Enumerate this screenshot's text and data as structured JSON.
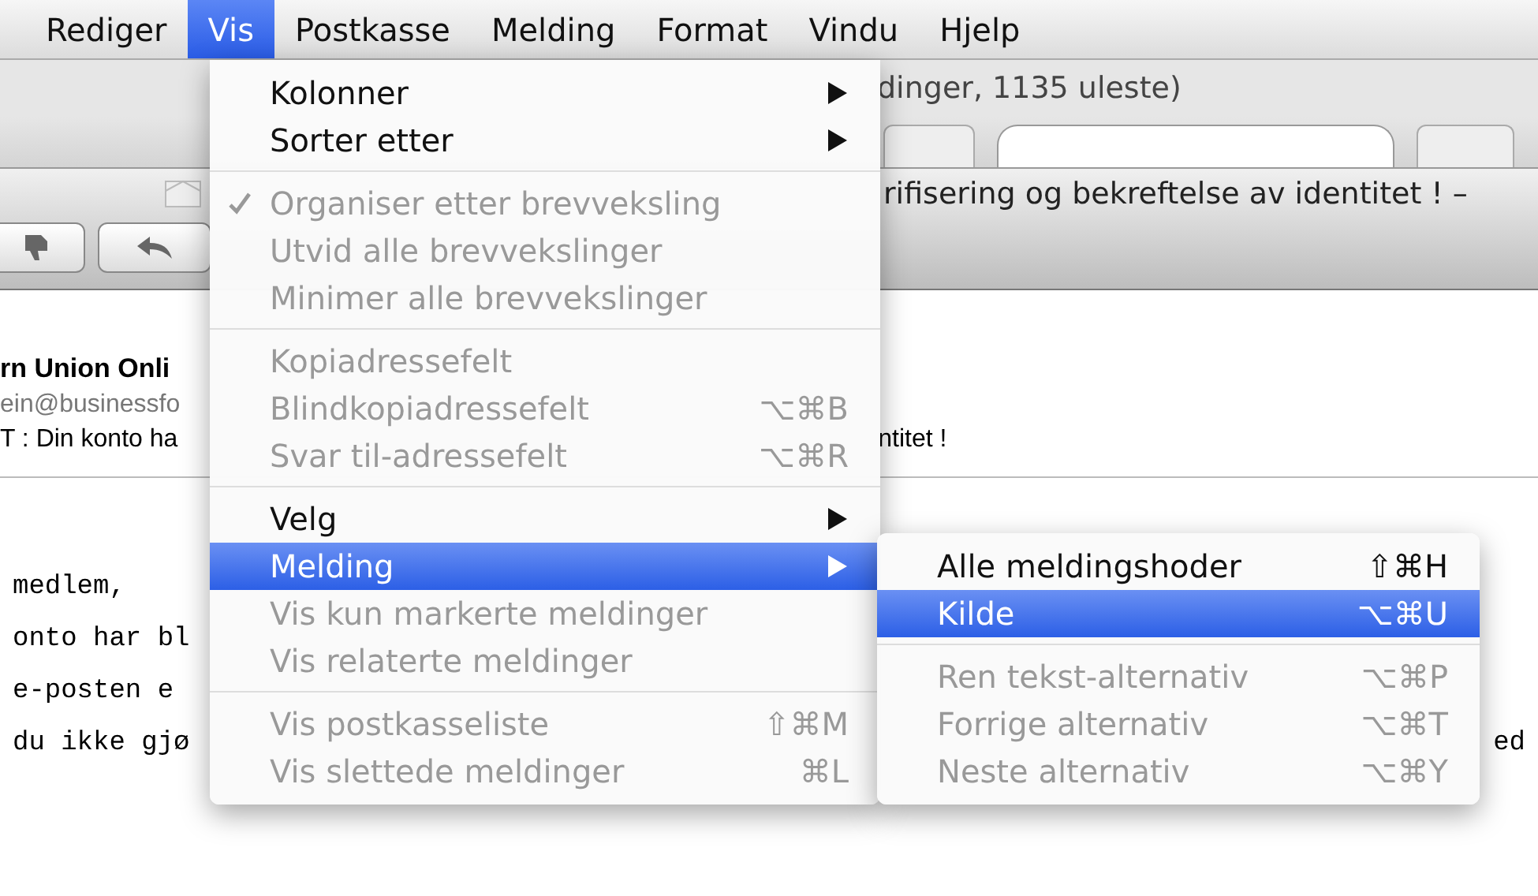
{
  "menu_bar": {
    "items": [
      {
        "label": "Rediger",
        "selected": false
      },
      {
        "label": "Vis",
        "selected": true
      },
      {
        "label": "Postkasse",
        "selected": false
      },
      {
        "label": "Melding",
        "selected": false
      },
      {
        "label": "Format",
        "selected": false
      },
      {
        "label": "Vindu",
        "selected": false
      },
      {
        "label": "Hjelp",
        "selected": false
      }
    ]
  },
  "window": {
    "title": "dinger, 1135 uleste)"
  },
  "message": {
    "title": "rifisering og bekreftelse av identitet ! –",
    "from_name": "rn Union Onli",
    "from_address": "ein@businessfo",
    "subject": "T : Din konto ha",
    "subject_tail": "ntitet !",
    "body_lines": [
      {
        "text": "medlem,"
      },
      {
        "text": "onto har bl"
      },
      {
        "text": "e-posten e"
      },
      {
        "text": "du ikke gjø",
        "tail": "ed"
      }
    ]
  },
  "vis_menu": {
    "items": [
      {
        "kind": "submenu",
        "label": "Kolonner",
        "disabled": false,
        "checked": false,
        "selected": false
      },
      {
        "kind": "submenu",
        "label": "Sorter etter",
        "disabled": false,
        "checked": false,
        "selected": false
      },
      {
        "kind": "separator"
      },
      {
        "kind": "item",
        "label": "Organiser etter brevveksling",
        "disabled": true,
        "checked": true,
        "selected": false
      },
      {
        "kind": "item",
        "label": "Utvid alle brevvekslinger",
        "disabled": true,
        "checked": false,
        "selected": false
      },
      {
        "kind": "item",
        "label": "Minimer alle brevvekslinger",
        "disabled": true,
        "checked": false,
        "selected": false
      },
      {
        "kind": "separator"
      },
      {
        "kind": "item",
        "label": "Kopiadressefelt",
        "disabled": true,
        "checked": false,
        "selected": false
      },
      {
        "kind": "item",
        "label": "Blindkopiadressefelt",
        "shortcut": "⌥⌘B",
        "disabled": true,
        "checked": false,
        "selected": false
      },
      {
        "kind": "item",
        "label": "Svar til-adressefelt",
        "shortcut": "⌥⌘R",
        "disabled": true,
        "checked": false,
        "selected": false
      },
      {
        "kind": "separator"
      },
      {
        "kind": "submenu",
        "label": "Velg",
        "disabled": false,
        "checked": false,
        "selected": false
      },
      {
        "kind": "submenu",
        "label": "Melding",
        "disabled": false,
        "checked": false,
        "selected": true
      },
      {
        "kind": "item",
        "label": "Vis kun markerte meldinger",
        "disabled": true,
        "checked": false,
        "selected": false
      },
      {
        "kind": "item",
        "label": "Vis relaterte meldinger",
        "disabled": true,
        "checked": false,
        "selected": false
      },
      {
        "kind": "separator"
      },
      {
        "kind": "item",
        "label": "Vis postkasseliste",
        "shortcut": "⇧⌘M",
        "disabled": true,
        "checked": false,
        "selected": false
      },
      {
        "kind": "item",
        "label": "Vis slettede meldinger",
        "shortcut": "⌘L",
        "disabled": true,
        "checked": false,
        "selected": false
      }
    ]
  },
  "melding_submenu": {
    "items": [
      {
        "kind": "item",
        "label": "Alle meldingshoder",
        "shortcut": "⇧⌘H",
        "disabled": false,
        "selected": false
      },
      {
        "kind": "item",
        "label": "Kilde",
        "shortcut": "⌥⌘U",
        "disabled": false,
        "selected": true
      },
      {
        "kind": "separator"
      },
      {
        "kind": "item",
        "label": "Ren tekst-alternativ",
        "shortcut": "⌥⌘P",
        "disabled": true,
        "selected": false
      },
      {
        "kind": "item",
        "label": "Forrige alternativ",
        "shortcut": "⌥⌘T",
        "disabled": true,
        "selected": false
      },
      {
        "kind": "item",
        "label": "Neste alternativ",
        "shortcut": "⌥⌘Y",
        "disabled": true,
        "selected": false
      }
    ]
  }
}
